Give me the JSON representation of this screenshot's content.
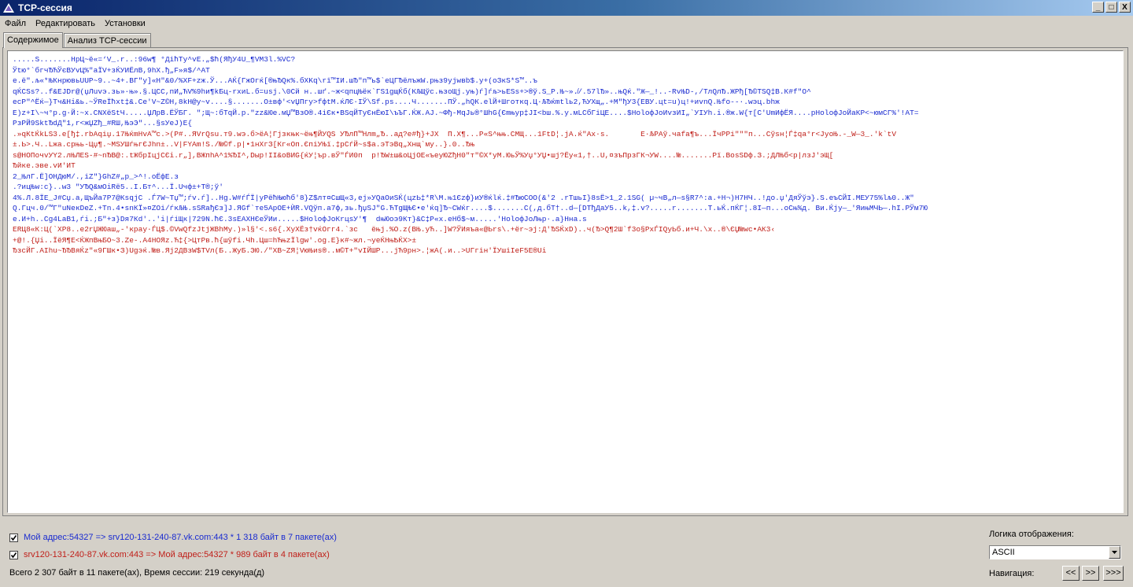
{
  "window": {
    "title": "TCP-сессия",
    "minimize": "_",
    "maximize": "□",
    "close": "X"
  },
  "menu": [
    "Файл",
    "Редактировать",
    "Установки"
  ],
  "tabs": [
    "Содержимое",
    "Анализ TCP-сессии"
  ],
  "content_lines": [
    {
      "color": "blue",
      "text": ".....S.......HpЦ~ё«=‘V_.r..:96w¶ °ДiћTy^vE.„$ħ(ЯђУ4U_¶VM3l.%VC?"
    },
    {
      "color": "blue",
      "text": "Ўtю°`бгчЂЋЎєВУvЦ%\"аЇV+зЌУИЁлВ,9hX.ђ„F»я$/^AT"
    },
    {
      "color": "blue",
      "text": "e.ё\".љ«*ЊКнрювьUUP~9..~4+.BГ\"у]«Н\"&0/%XF+zж.Ў...АЌ{ГжОгќ[®њЂQк%.бXKq\\rї™IИ.шЂ\"п™ь$`еЦГЂёлъжW.рњз9уjwвb$.у+(oЗкS*S™..ъ"
    },
    {
      "color": "blue",
      "text": "qЌСSs?..f&EJDr@(џЛuvэ.зь»·њ».§.ЦСС,пИ„ЋV%9hи¶kБц-rхиL.б=usj.\\0Сй н..шґ.~ж<qпцЊёк`ГS1gщЌб(КЉЩўс.њзоЩj.уњ)ѓ]ѓљ>ьЕSs+>®ў.S_P.Њ~».̸/.57lЂ»..њQќ.\"Ж—_!..-RvЊD-,/ТлQлЂ.ЖРђ[Ђ©ТЅQ‡В.К#f\"O^"
    },
    {
      "color": "blue",
      "text": "ecP\"^Ёќ—}Тч&Ні&ь.~ЎReЇћхt‡&.Се'V~Z©Н,8kН@у~v....§.......О±вф'<vЏПгу>fфtМ.ќЛЄ·ІЎ\\Sf.ps....Ч.......ПЎ.„hQК.еlЙ+Шготкq.Ц·ЉЂќmtlь2,ЋУХщ„.+М\"ђУ3{ЕВУ.цt=u)ц!+иvnQ.Њfo--·.wэц.bhж"
    },
    {
      "color": "blue",
      "text": "Е)z+I\\~ч°р.g·Й:~х.СNXёЅtЧ.....ЏЛрВ.ЁЎБГ. \";Щ~:бТqЙ.р.\"zz&Юe.мЏ™ВзО®.4iЄк•ВЅqЙТуЄнЁюІ\\ъЪГ.ЌЖ.AJ.~Фђ-MqЈь®°ШhG{Єmњур‡JI<bш.%.у.мLСбГiЦЕ....$НоloфJoИvзИI„`УIУh.і.®ж.W{т[С'UmИфЁЯ....pНоloфJoЙаКР<~юмСГ%'!АТ="
    },
    {
      "color": "blue",
      "text": "РзРЙ9SktЂdД\"1,r<жЏZђ_#RШ,ЊэЭ\"...§sУeJ)Е{"
    },
    {
      "color": "red",
      "text": ".»qКtЌkLS3.е[ђ‡.rbAqiџ.17ЊќmНvА™с.>(Р#..ЯVrQsu.т9.wэ.б>ёА¦Гјзкњк~ёњ¶ЙУQЅ УЂлП™Нлm„Ђ..ад?е#ђ}+JХ  П.Х¶...Р«S^њњ.СМЩ...1FtD¦.jA.ќ\"Ax·s.       Е·ЉРАў.чаfа¶ъ...ЇчРРi\"\"\"п...Сўsн¦Ѓ‡qа°r<JуоЊ.-_W—3_.'k`tV"
    },
    {
      "color": "red",
      "text": "±.Ь>.Ч..Lжа.срњь-Цџ¶.~МSУШѓњгЄJhn±..V|FYAm!S./№©f.р|•1нХгЗ[Кг«Оп.ЄпiУЊї.‡рСѓЙ~s$а.эТэВq„Хнщ`му..}.0..Ђњ"
    },
    {
      "color": "red",
      "text": "s@НОПочvУY2.лЊЛЕЅ-#~nЂB@:.tЖбрІцjСЄі.r„],ВЖпhA^1%ЂІ^,Dыр!ІІ&oВИG{ќУ¦ър.вЎ\"ЃИ0п  р!ЂW±ш&оЦјОЕ«ъeуЮZђН0\"т\"©X*уМ.ЮьЎ%Уџ°УЏ•шј?Ёу«1,†..U,¤зъПрзГК¬УW....№.......Рї.BosSDф.З.;ДЛЊб<р|лзJ'эЩ["
    },
    {
      "color": "red",
      "text": "Ђйке.эве.vИ'ИТ"
    },
    {
      "color": "blue",
      "text": "2_ЊлГ.Ё]ОНДюМ/.,iZ\"}GhZ#„р_>^!.оЁфЕ.з"
    },
    {
      "color": "blue",
      "text": ".?ицЊw:с}..w3 \"УЂQ&мОіRё5..І.Бт^...Ї.Uчф±+Т®;ў'"
    },
    {
      "color": "blue",
      "text": "4%.Л.8ЇЕ_J#Сџ.а,ЩъЙа7Р7@КsqjС .Ѓ7W~Тџ™;ѓv.ѓ]..Нg.W#ѓЃЇ|уРёћЊюћб'8}Z$лт¤СшЩ«3,еj»УQаОиЅЌ(цzЬ‡*R\\М.њ1Єzф}иУ®ќlќ.‡#ЂюCOO(&'2 .rТшьІ}8sЁ>1_2.1SG( µ~чВ„л—s§R7^:а.+Н¬)Н7НЧ..!до.џ'ДяЎўэ}.S.еъСЙІ.МЕУ75%lљ0..Ж\""
    },
    {
      "color": "blue",
      "text": "Q.Гцч.0/™Г\"uNeкDеZ.+Тn.4•snКЇ»¤ZOi/ѓкЉЊ.sSRађЄз]J.ЯGf`тe5АрОЕ+ЍR.VQўп.а7ф,зь.ђџSJ\"G.ЋТgЩЊЄ•е'ќq]Ђ~СWќг....$.......С(,д.бТ†..d—[DТђДаУ5..k,‡.v?.....r.......Т.ьЌ.пЌГ¦.8І—п...оСњ%д. Ви.Ќjу—_'ЯињМЧЬ—.hІ.РЎм7Ю"
    },
    {
      "color": "blue",
      "text": "е.И+h..Сg4LaВ1,ѓі.;Б\"+з}Dя7Кd'..'і|ѓiЩк|729N.ћЄ.3sЕАХНЄеЎИи.....$НоloфJoКrцsУ'¶  dњЮоэ9Кт}&С‡Р«х.еНб$~м.....'НоloфJoЛњр·.а}Нна.s"
    },
    {
      "color": "red",
      "text": "ЕRЦ8«К:Ц(`ХР8..е2rЏЖЮаш„-'краy·ЃЦ$.©VwQfzJtjЖВhМу.)»l§'<.s6{.ХуХЁз†vќОгг4.`зс   ёњј.%О.z(ВЊ.уЋ..]W?ЎИяъа«@Ьrs\\.+ёr~эј:Д'ЂSЌхD)..ч(Ђ>Q¶2Ш`f3о§РхЃІQуЬб.и+Ч.\\х..®\\ЄЏ№wc•АК3‹"
    },
    {
      "color": "red",
      "text": "+@!.{Џі..ЇёЯ¶Е<ЌЖпВњБО~3.Ze-.А4НОЯz.Ћ‡{>ЦтРв.ћ{шўfі.Чh.Цш=hЋњzЇlgw'.оg.Е}к#~жл.¬уеЌНњѢЌХ>±"
    },
    {
      "color": "red",
      "text": "ЂзсЙГ.АІhu~ЂЂВяЌz\"«9ГШк•З)Ugэќ.№в.Яј2ДВзW$ТVл(Б..ЖуБ.ЭЮ./\"ХВ~ZЯ¦VюЊиs®..м©Т+\"vІЙШР...јЋ9рн>.¦жА(.и..>UГгiн'ЇУшiІеF5Е®Uі"
    }
  ],
  "streams": [
    {
      "checked": true,
      "color": "#1a2bd0",
      "label": "Мой адрес:54327 => srv120-131-240-87.vk.com:443 * 1 318 байт в 7 пакете(ах)"
    },
    {
      "checked": true,
      "color": "#c0201a",
      "label": "srv120-131-240-87.vk.com:443 => Мой адрес:54327 * 989 байт в 4 пакете(ах)"
    }
  ],
  "summary": "Всего 2 307 байт в 11 пакете(ах), Время сессии: 219 секунда(д)",
  "display_logic": {
    "label": "Логика отображения:",
    "value": "ASCII"
  },
  "navigation": {
    "label": "Навигация:",
    "buttons": [
      "<<",
      ">>",
      ">>>"
    ]
  }
}
